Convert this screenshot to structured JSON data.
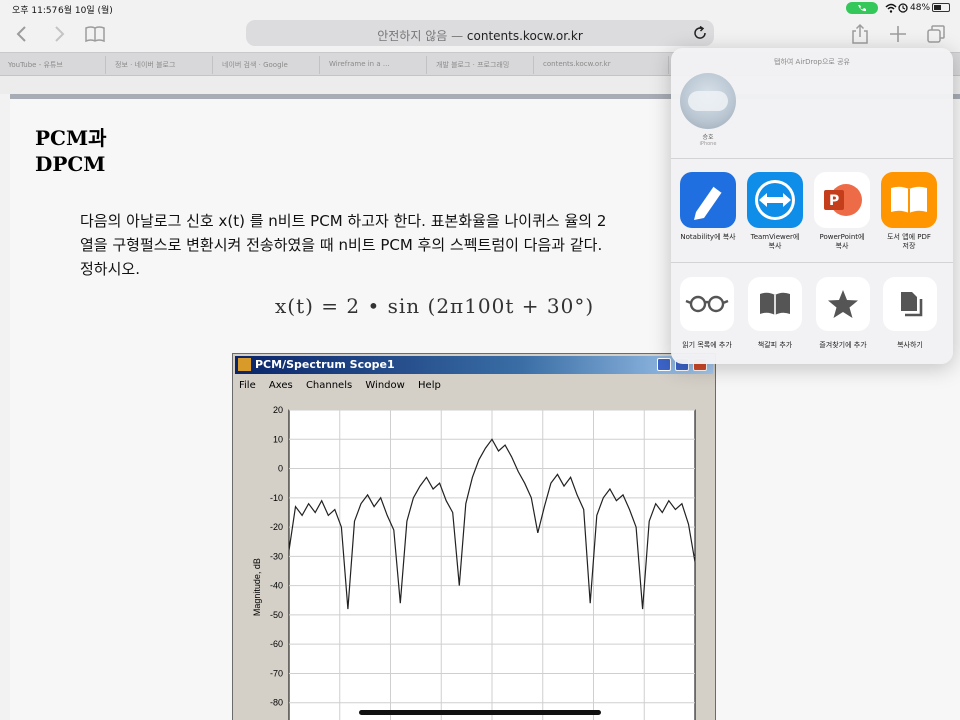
{
  "status": {
    "time": "오후 11:57",
    "date": "6월 10일 (월)",
    "battery_pct": "48%",
    "battery_level": 0.48,
    "call_color": "#34c759"
  },
  "toolbar": {
    "back_icon": "chevron-left-icon",
    "forward_icon": "chevron-right-icon",
    "bookmarks_icon": "book-icon",
    "address_prefix": "안전하지 않음 — ",
    "address_host": "contents.kocw.or.kr",
    "reload_icon": "reload-icon",
    "share_icon": "share-icon",
    "new_tab_icon": "plus-icon",
    "tabs_icon": "tabs-icon"
  },
  "tabs": [
    "YouTube - 유튜브",
    "정보 · 네이버 블로그",
    "네이버 검색 · Google",
    "Wireframe in a ...",
    "개발 블로그 · 프로그래밍",
    "contents.kocw.or.kr"
  ],
  "document": {
    "heading_line1": "PCM과",
    "heading_line2": "DPCM",
    "para_line1": "다음의 아날로그 신호 x(t) 를 n비트 PCM 하고자 한다. 표본화율을 나이퀴스 율의 2",
    "para_line2": "열을 구형펄스로 변환시켜 전송하였을 때 n비트 PCM 후의 스펙트럼이 다음과 같다.",
    "para_line3": "정하시오.",
    "formula_lhs": "x(t) = 2 • sin (2π100t + 30°)"
  },
  "scope": {
    "title": "PCM/Spectrum Scope1",
    "menu": [
      "File",
      "Axes",
      "Channels",
      "Window",
      "Help"
    ],
    "ylabel": "Magnitude, dB"
  },
  "chart_data": {
    "type": "line",
    "title": "",
    "xlabel": "",
    "ylabel": "Magnitude, dB",
    "ylim": [
      -90,
      20
    ],
    "yticks": [
      20,
      10,
      0,
      -10,
      -20,
      -30,
      -40,
      -50,
      -60,
      -70,
      -80
    ],
    "grid": true,
    "series": [
      {
        "values": [
          -28,
          -13,
          -16,
          -12,
          -15,
          -11,
          -16,
          -14,
          -20,
          -48,
          -18,
          -12,
          -9,
          -13,
          -10,
          -16,
          -21,
          -46,
          -18,
          -10,
          -6,
          -3,
          -7,
          -5,
          -11,
          -15,
          -40,
          -12,
          -3,
          3,
          7,
          10,
          6,
          8,
          4,
          -1,
          -5,
          -10,
          -22,
          -13,
          -5,
          -2,
          -6,
          -3,
          -9,
          -14,
          -46,
          -16,
          -10,
          -7,
          -11,
          -9,
          -14,
          -20,
          -48,
          -18,
          -12,
          -15,
          -11,
          -14,
          -12,
          -19,
          -32
        ]
      }
    ]
  },
  "share_sheet": {
    "caption": "탭하여 AirDrop으로 공유",
    "airdrop_name": "승호",
    "airdrop_device": "iPhone",
    "apps": [
      {
        "label": "Notability에 복사",
        "icon": "notability-icon",
        "color": "#1f6fe0"
      },
      {
        "label": "TeamViewer에\n복사",
        "icon": "teamviewer-icon",
        "color": "#0e8ee9"
      },
      {
        "label": "PowerPoint에\n복사",
        "icon": "powerpoint-icon",
        "color": "#ffffff"
      },
      {
        "label": "도서 앱에 PDF\n저장",
        "icon": "books-icon",
        "color": "#ff9500"
      }
    ],
    "actions": [
      {
        "label": "읽기 목록에 추가",
        "icon": "glasses-icon"
      },
      {
        "label": "책갈피 추가",
        "icon": "book-icon"
      },
      {
        "label": "즐겨찾기에 추가",
        "icon": "star-icon"
      },
      {
        "label": "복사하기",
        "icon": "copy-icon"
      }
    ]
  }
}
